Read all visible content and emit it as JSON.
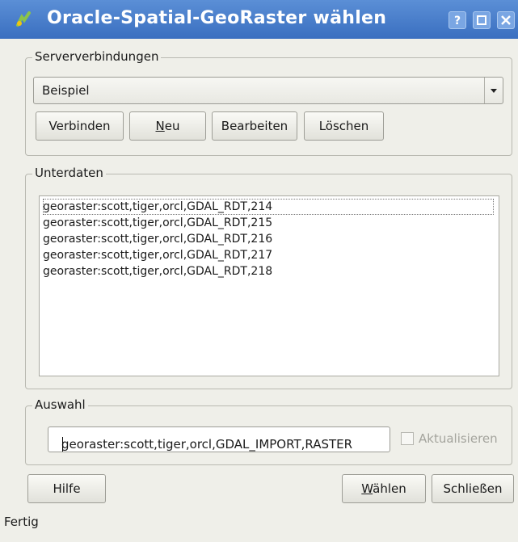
{
  "window": {
    "title": "Oracle-Spatial-GeoRaster wählen",
    "buttons": {
      "help": "?",
      "maximize": "□",
      "close": "×"
    }
  },
  "server": {
    "group_title": "Serververbindungen",
    "selected": "Beispiel",
    "buttons": {
      "connect": "Verbinden",
      "new_underline": "N",
      "new_rest": "eu",
      "edit": "Bearbeiten",
      "delete": "Löschen"
    }
  },
  "subdata": {
    "group_title": "Unterdaten",
    "items": [
      "georaster:scott,tiger,orcl,GDAL_RDT,214",
      "georaster:scott,tiger,orcl,GDAL_RDT,215",
      "georaster:scott,tiger,orcl,GDAL_RDT,216",
      "georaster:scott,tiger,orcl,GDAL_RDT,217",
      "georaster:scott,tiger,orcl,GDAL_RDT,218"
    ]
  },
  "selection": {
    "group_title": "Auswahl",
    "value": "georaster:scott,tiger,orcl,GDAL_IMPORT,RASTER",
    "refresh_label": "Aktualisieren",
    "refresh_checked": false
  },
  "footer": {
    "help": "Hilfe",
    "choose_underline": "W",
    "choose_rest": "ählen",
    "close": "Schließen",
    "status": "Fertig"
  },
  "colors": {
    "titlebar": "#3a6fc0",
    "background": "#efefe9"
  }
}
